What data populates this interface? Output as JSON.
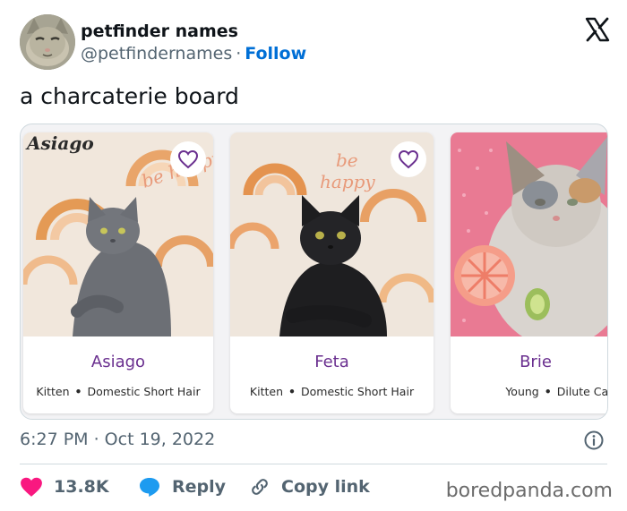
{
  "author": {
    "name": "petfinder names",
    "handle": "@petfindernames",
    "separator": "·",
    "follow_label": "Follow"
  },
  "tweet": {
    "text": "a charcaterie board",
    "timestamp": "6:27 PM · Oct 19, 2022"
  },
  "cards": [
    {
      "photo_label": "Asiago",
      "name": "Asiago",
      "age": "Kitten",
      "breed": "Domestic Short Hair"
    },
    {
      "photo_label": "",
      "name": "Feta",
      "age": "Kitten",
      "breed": "Domestic Short Hair"
    },
    {
      "photo_label": "",
      "name": "Brie",
      "age": "Young",
      "breed": "Dilute Calic"
    }
  ],
  "meta_dot": "•",
  "actions": {
    "likes": "13.8K",
    "reply_label": "Reply",
    "copy_link_label": "Copy link"
  },
  "watermark": "boredpanda.com",
  "colors": {
    "follow": "#006fd6",
    "heart": "#f91880",
    "reply": "#1d9bf0",
    "pet_name": "#6a2f8f"
  },
  "icons": [
    "x-logo-icon",
    "heart-outline-icon",
    "info-icon",
    "heart-filled-icon",
    "reply-bubble-icon",
    "link-icon"
  ]
}
